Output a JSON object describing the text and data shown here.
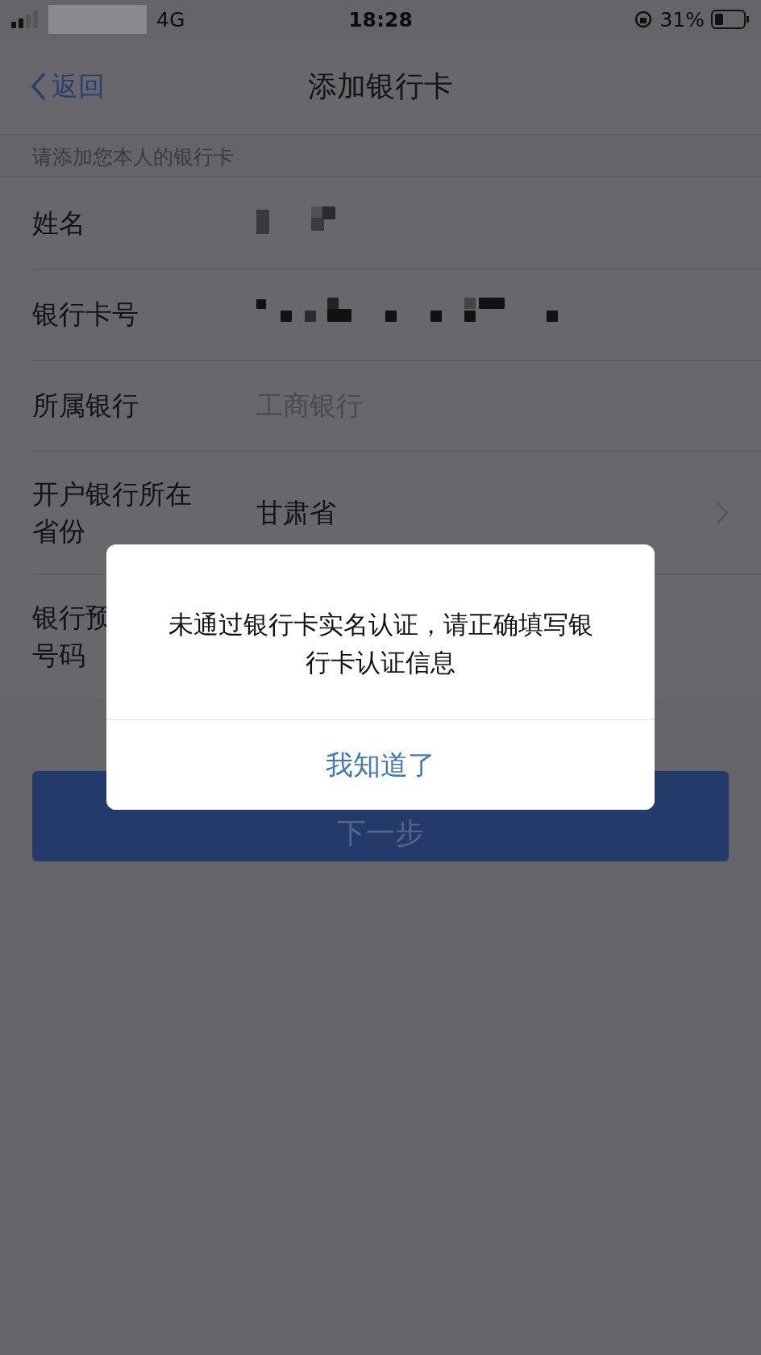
{
  "status_bar": {
    "network": "4G",
    "time": "18:28",
    "battery": "31%"
  },
  "nav": {
    "back": "返回",
    "title": "添加银行卡"
  },
  "hint": "请添加您本人的银行卡",
  "fields": [
    {
      "kind": "masked",
      "label": "姓名"
    },
    {
      "kind": "masked",
      "label": "银行卡号"
    },
    {
      "kind": "placeholder",
      "label": "所属银行",
      "placeholder": "工商银行"
    },
    {
      "kind": "select",
      "label": "开户银行所在省份",
      "value": "甘肃省"
    },
    {
      "kind": "covered",
      "label": "银行预",
      "label_line2": "号码"
    }
  ],
  "next_button": {
    "label": "下一步"
  },
  "dialog": {
    "message": "未通过银行卡实名认证，请正确填写银行卡认证信息",
    "button": "我知道了"
  }
}
